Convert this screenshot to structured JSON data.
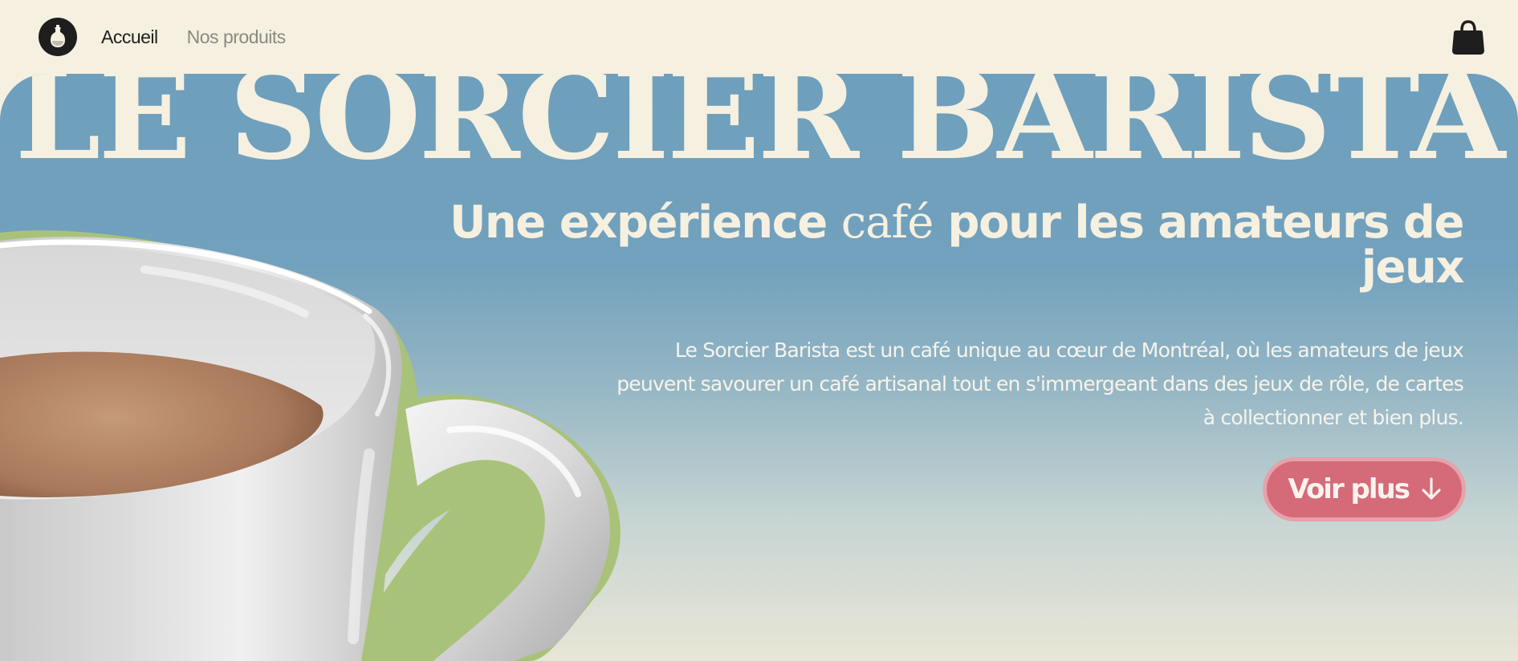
{
  "nav": {
    "logo_icon": "potion-bottle-icon",
    "links": [
      {
        "label": "Accueil",
        "active": true
      },
      {
        "label": "Nos produits",
        "active": false
      }
    ],
    "cart_icon": "shopping-bag-icon"
  },
  "hero": {
    "title": "LE SORCIER BARISTA",
    "headline_part1": "Une expérience ",
    "headline_serif": "café",
    "headline_part2": " pour les amateurs de jeux",
    "description": "Le Sorcier Barista est un café unique au cœur de Montréal, où les amateurs de jeux peuvent savourer un café artisanal tout en s'immergeant dans des jeux de rôle, de cartes à collectionner et bien plus.",
    "cta_label": "Voir plus",
    "cta_icon": "arrow-down-icon",
    "image": "coffee-cup-image"
  },
  "colors": {
    "background": "#f6f0e0",
    "hero_top": "#6e9fbc",
    "hero_bottom": "#e8e6d6",
    "cta": "#d56a78",
    "cup_outline": "#a9c27a",
    "text_dark": "#1e1e1e"
  }
}
